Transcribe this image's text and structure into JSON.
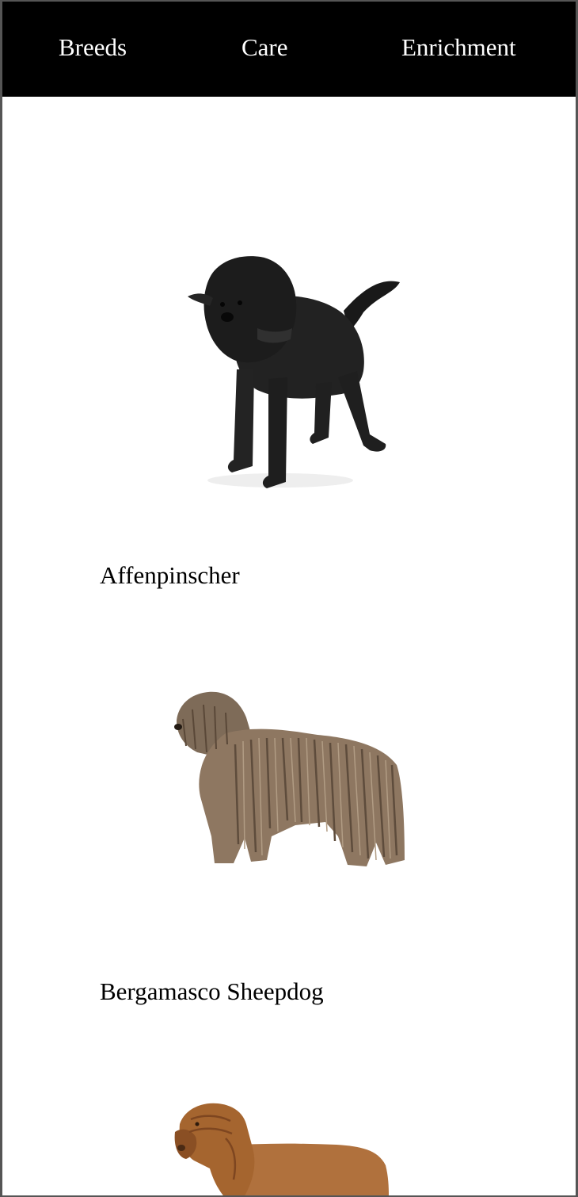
{
  "nav": {
    "items": [
      {
        "label": "Breeds"
      },
      {
        "label": "Care"
      },
      {
        "label": "Enrichment"
      }
    ]
  },
  "breeds": [
    {
      "name": "Affenpinscher",
      "image_icon": "black-wiry-small-dog-photo"
    },
    {
      "name": "Bergamasco Sheepdog",
      "image_icon": "corded-coat-sheepdog-photo"
    },
    {
      "name": "",
      "image_icon": "brown-mastiff-dog-photo"
    }
  ],
  "colors": {
    "nav_background": "#000000",
    "nav_text": "#ffffff",
    "page_background": "#ffffff",
    "text": "#000000"
  }
}
